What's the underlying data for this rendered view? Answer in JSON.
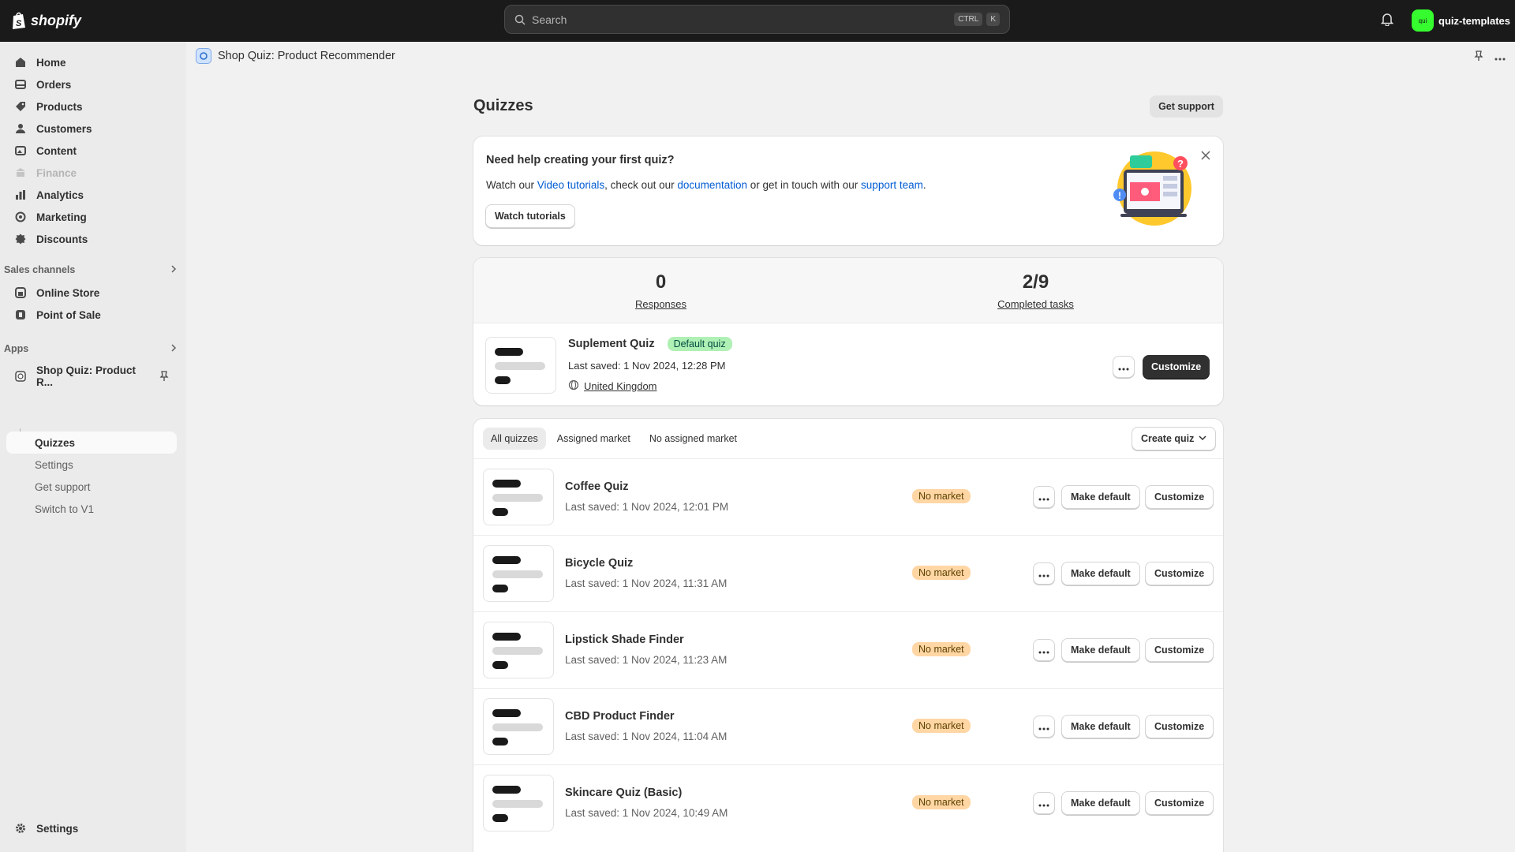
{
  "topbar": {
    "brand": "shopify",
    "search_placeholder": "Search",
    "kbd1": "CTRL",
    "kbd2": "K",
    "store_initials": "qui",
    "store_name": "quiz-templates"
  },
  "sidebar": {
    "items": [
      {
        "label": "Home",
        "icon": "home-icon"
      },
      {
        "label": "Orders",
        "icon": "inbox-icon"
      },
      {
        "label": "Products",
        "icon": "tag-icon"
      },
      {
        "label": "Customers",
        "icon": "person-icon"
      },
      {
        "label": "Content",
        "icon": "image-icon"
      },
      {
        "label": "Finance",
        "icon": "bank-icon",
        "disabled": true
      },
      {
        "label": "Analytics",
        "icon": "chart-icon"
      },
      {
        "label": "Marketing",
        "icon": "target-icon"
      },
      {
        "label": "Discounts",
        "icon": "discount-icon"
      }
    ],
    "sales_channels_heading": "Sales channels",
    "channels": [
      {
        "label": "Online Store",
        "icon": "store-icon"
      },
      {
        "label": "Point of Sale",
        "icon": "pos-icon"
      }
    ],
    "apps_heading": "Apps",
    "app_name": "Shop Quiz: Product R...",
    "app_subitems": [
      "Quizzes",
      "Settings",
      "Get support",
      "Switch to V1"
    ],
    "settings_label": "Settings"
  },
  "main": {
    "app_title": "Shop Quiz: Product Recommender",
    "page_title": "Quizzes",
    "get_support": "Get support",
    "help": {
      "title": "Need help creating your first quiz?",
      "text1": "Watch our ",
      "link1": "Video tutorials",
      "text2": ", check out our ",
      "link2": "documentation",
      "text3": " or get in touch with our ",
      "link3": "support team",
      "text4": ".",
      "button": "Watch tutorials"
    },
    "stats": {
      "responses_value": "0",
      "responses_label": "Responses",
      "tasks_value": "2/9",
      "tasks_label": "Completed tasks"
    },
    "default_quiz": {
      "name": "Suplement Quiz",
      "badge": "Default quiz",
      "saved": "Last saved: 1 Nov 2024, 12:28 PM",
      "market": "United Kingdom",
      "customize": "Customize"
    },
    "tabs": [
      "All quizzes",
      "Assigned market",
      "No assigned market"
    ],
    "create_quiz": "Create quiz",
    "quizzes": [
      {
        "name": "Coffee Quiz",
        "saved": "Last saved: 1 Nov 2024, 12:01 PM",
        "badge": "No market",
        "make_default": "Make default",
        "customize": "Customize"
      },
      {
        "name": "Bicycle Quiz",
        "saved": "Last saved: 1 Nov 2024, 11:31 AM",
        "badge": "No market",
        "make_default": "Make default",
        "customize": "Customize"
      },
      {
        "name": "Lipstick Shade Finder",
        "saved": "Last saved: 1 Nov 2024, 11:23 AM",
        "badge": "No market",
        "make_default": "Make default",
        "customize": "Customize"
      },
      {
        "name": "CBD Product Finder",
        "saved": "Last saved: 1 Nov 2024, 11:04 AM",
        "badge": "No market",
        "make_default": "Make default",
        "customize": "Customize"
      },
      {
        "name": "Skincare Quiz (Basic)",
        "saved": "Last saved: 1 Nov 2024, 10:49 AM",
        "badge": "No market",
        "make_default": "Make default",
        "customize": "Customize"
      }
    ]
  },
  "colors": {
    "topbar": "#1a1a1a",
    "link": "#005bd3",
    "badge_green": "#aff0b5",
    "badge_orange": "#ffd6a4",
    "avatar_green": "#36fc2f"
  }
}
